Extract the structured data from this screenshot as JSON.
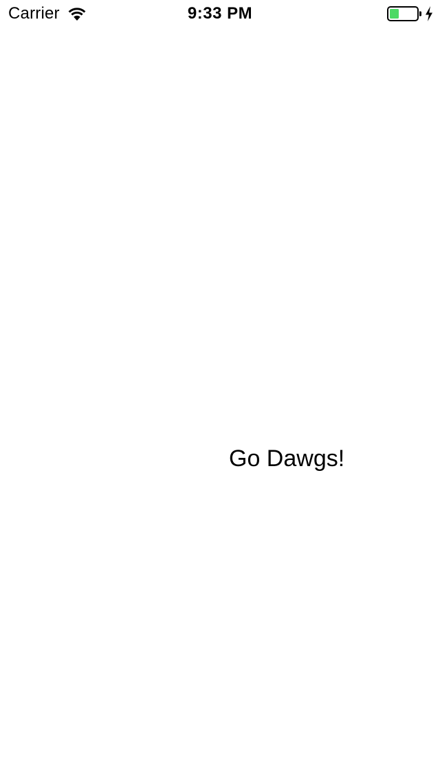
{
  "status_bar": {
    "carrier": "Carrier",
    "time": "9:33 PM",
    "wifi_icon": "wifi-icon",
    "battery_icon": "battery-icon",
    "charging_icon": "lightning-bolt-icon",
    "battery_level": 0.35,
    "battery_color": "#4cd964"
  },
  "main": {
    "greeting": "Go Dawgs!"
  }
}
